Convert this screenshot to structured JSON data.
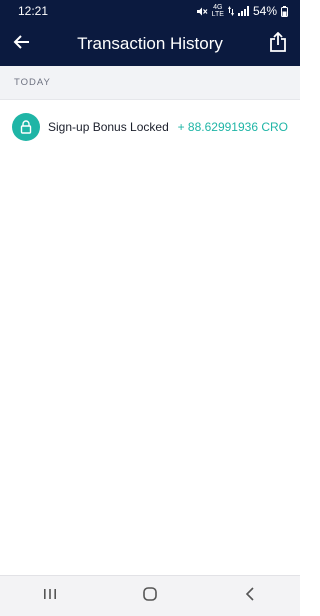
{
  "status_bar": {
    "time": "12:21",
    "network_label": "4G",
    "network_sub": "LTE",
    "battery": "54%"
  },
  "header": {
    "title": "Transaction History"
  },
  "sections": [
    {
      "label": "TODAY",
      "transactions": [
        {
          "icon": "lock-icon",
          "title": "Sign-up Bonus Locked",
          "amount": "+ 88.62991936 CRO"
        }
      ]
    }
  ],
  "colors": {
    "header_bg": "#0b1a3f",
    "accent": "#1fb5a6",
    "section_bg": "#f2f3f6"
  }
}
